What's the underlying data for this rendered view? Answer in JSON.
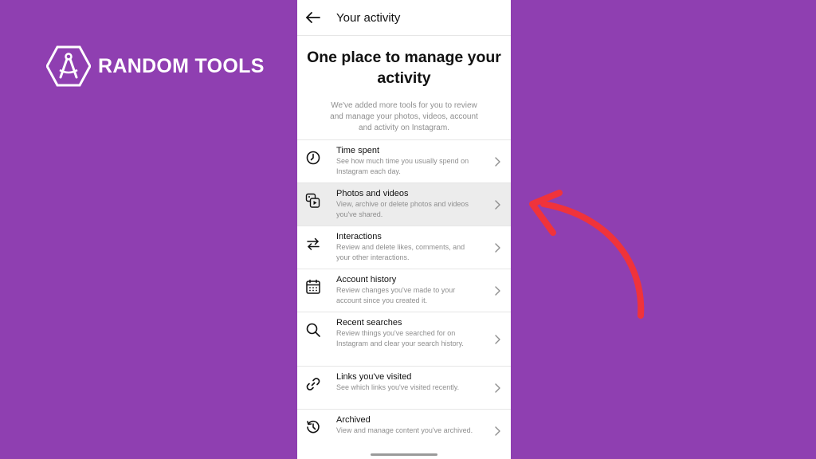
{
  "brand": {
    "name": "RANDOM TOOLS",
    "logo_icon": "compass-hexagon-icon"
  },
  "header": {
    "back_icon": "arrow-left-icon",
    "title": "Your activity"
  },
  "intro": {
    "headline": "One place to manage your activity",
    "description": "We've added more tools for you to review and manage your photos, videos, account and activity on Instagram."
  },
  "menu": {
    "items": [
      {
        "icon": "clock-icon",
        "title": "Time spent",
        "subtitle": "See how much time you usually spend on Instagram each day."
      },
      {
        "icon": "photos-video-icon",
        "title": "Photos and videos",
        "subtitle": "View, archive or delete photos and videos you've shared."
      },
      {
        "icon": "arrows-exchange-icon",
        "title": "Interactions",
        "subtitle": "Review and delete likes, comments, and your other interactions."
      },
      {
        "icon": "calendar-icon",
        "title": "Account history",
        "subtitle": "Review changes you've made to your account since you created it."
      },
      {
        "icon": "search-icon",
        "title": "Recent searches",
        "subtitle": "Review things you've searched for on Instagram and clear your search history."
      },
      {
        "icon": "link-icon",
        "title": "Links you've visited",
        "subtitle": "See which links you've visited recently."
      },
      {
        "icon": "history-icon",
        "title": "Archived",
        "subtitle": "View and manage content you've archived."
      }
    ]
  },
  "colors": {
    "background": "#8f3fb1",
    "arrow": "#f0333b",
    "highlight_row": "#ececec"
  }
}
